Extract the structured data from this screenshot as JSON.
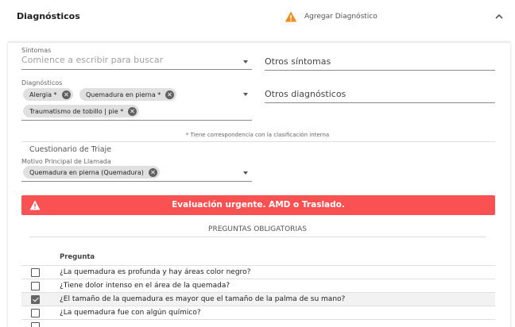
{
  "header": {
    "title": "Diagnósticos",
    "add_label": "Agregar Diagnóstico",
    "warn_icon": "warning-icon",
    "collapse_icon": "chevron-up-icon"
  },
  "sintomas": {
    "label": "Síntomas",
    "placeholder": "Comience a escribir para buscar",
    "otros_placeholder": "Otros síntomas"
  },
  "diagnosticos": {
    "label": "Diagnósticos",
    "chips": [
      "Alergia *",
      "Quemadura en pierna *",
      "Traumatismo de tobillo | pie *"
    ],
    "otros_placeholder": "Otros diagnósticos"
  },
  "note": "* Tiene correspondencia con la clasificación interna",
  "triaje": {
    "title": "Cuestionario de Triaje",
    "motivo_label": "Motivo Principal de Llamada",
    "motivo_chip": "Quemadura en pierna (Quemadura)"
  },
  "alert": {
    "text": "Evaluación urgente. AMD o Traslado.",
    "color": "#fa5252"
  },
  "preguntas": {
    "title": "PREGUNTAS OBLIGATORIAS",
    "header": "Pregunta",
    "rows": [
      {
        "text": "¿La quemadura es profunda y hay áreas color negro?",
        "checked": false
      },
      {
        "text": "¿Tiene dolor intenso en el área de la quemada?",
        "checked": false
      },
      {
        "text": "¿El tamaño de la quemadura es mayor que el tamaño de la palma de su mano?",
        "checked": true
      },
      {
        "text": "¿La quemadura fue con algún químico?",
        "checked": false
      }
    ]
  }
}
